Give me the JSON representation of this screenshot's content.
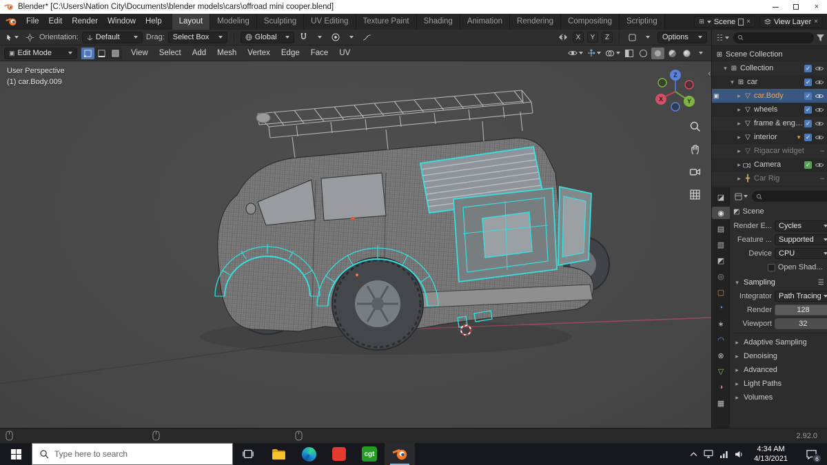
{
  "titlebar": {
    "title": "Blender* [C:\\Users\\Nation City\\Documents\\blender models\\cars\\offroad mini cooper.blend]"
  },
  "menubar": {
    "menus": [
      "File",
      "Edit",
      "Render",
      "Window",
      "Help"
    ],
    "workspaces": [
      "Layout",
      "Modeling",
      "Sculpting",
      "UV Editing",
      "Texture Paint",
      "Shading",
      "Animation",
      "Rendering",
      "Compositing",
      "Scripting"
    ],
    "scene_value": "Scene",
    "view_layer_value": "View Layer"
  },
  "tool_settings": {
    "orientation_label": "Orientation:",
    "orientation_value": "Default",
    "drag_label": "Drag:",
    "drag_value": "Select Box",
    "transform_orientation": "Global",
    "mirror": {
      "x": "X",
      "y": "Y",
      "z": "Z"
    },
    "options_label": "Options"
  },
  "viewport_header": {
    "mode": "Edit Mode",
    "menus": [
      "View",
      "Select",
      "Add",
      "Mesh",
      "Vertex",
      "Edge",
      "Face",
      "UV"
    ]
  },
  "viewport": {
    "perspective_label": "User Perspective",
    "active_object_label": "(1) car.Body.009",
    "gizmo": {
      "x": "X",
      "y": "Y",
      "z": "Z"
    }
  },
  "outliner": {
    "items": [
      {
        "label": "Scene Collection"
      },
      {
        "label": "Collection"
      },
      {
        "label": "car"
      },
      {
        "label": "car.Body"
      },
      {
        "label": "wheels"
      },
      {
        "label": "frame & engine"
      },
      {
        "label": "interior"
      },
      {
        "label": "Rigacar widget"
      },
      {
        "label": "Camera"
      },
      {
        "label": "Car Rig"
      }
    ]
  },
  "properties": {
    "breadcrumb": "Scene",
    "render_engine_label": "Render E...",
    "render_engine_value": "Cycles",
    "feature_set_label": "Feature ...",
    "feature_set_value": "Supported",
    "device_label": "Device",
    "device_value": "CPU",
    "osl_label": "Open Shad...",
    "sampling_section_label": "Sampling",
    "integrator_label": "Integrator",
    "integrator_value": "Path Tracing",
    "render_samples_label": "Render",
    "render_samples_value": "128",
    "viewport_samples_label": "Viewport",
    "viewport_samples_value": "32",
    "collapsed_sections": [
      "Adaptive Sampling",
      "Denoising",
      "Advanced",
      "Light Paths",
      "Volumes"
    ]
  },
  "statusbar": {
    "version": "2.92.0"
  },
  "taskbar": {
    "search_placeholder": "Type here to search",
    "cgt_label": "cgt",
    "clock_time": "4:34 AM",
    "clock_date": "4/13/2021",
    "notification_count": "6"
  }
}
